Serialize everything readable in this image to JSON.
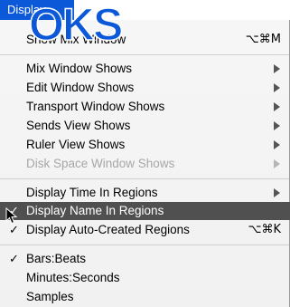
{
  "menu": {
    "title": "Display",
    "overlay_text": "OKS",
    "items": [
      {
        "label": "Show Mix Window",
        "shortcut": "⌥⌘M",
        "submenu": false,
        "checked": false,
        "enabled": true
      },
      {
        "label": "Mix Window Shows",
        "submenu": true,
        "checked": false,
        "enabled": true
      },
      {
        "label": "Edit Window Shows",
        "submenu": true,
        "checked": false,
        "enabled": true
      },
      {
        "label": "Transport Window Shows",
        "submenu": true,
        "checked": false,
        "enabled": true
      },
      {
        "label": "Sends View Shows",
        "submenu": true,
        "checked": false,
        "enabled": true
      },
      {
        "label": "Ruler View Shows",
        "submenu": true,
        "checked": false,
        "enabled": true
      },
      {
        "label": "Disk Space Window Shows",
        "submenu": true,
        "checked": false,
        "enabled": false
      },
      {
        "label": "Display Time In Regions",
        "submenu": true,
        "checked": false,
        "enabled": true
      },
      {
        "label": "Display Name In Regions",
        "submenu": false,
        "checked": true,
        "enabled": true,
        "highlighted": true
      },
      {
        "label": "Display Auto-Created Regions",
        "shortcut": "⌥⌘K",
        "submenu": false,
        "checked": true,
        "enabled": true
      },
      {
        "label": "Bars:Beats",
        "submenu": false,
        "checked": true,
        "enabled": true
      },
      {
        "label": "Minutes:Seconds",
        "submenu": false,
        "checked": false,
        "enabled": true
      },
      {
        "label": "Samples",
        "submenu": false,
        "checked": false,
        "enabled": true
      }
    ],
    "check_glyph": "✓",
    "colors": {
      "menu_title_bg": "#0b59d9",
      "highlight_bg": "#505050",
      "overlay_fill": "#0b59d9",
      "disabled_text": "#a7a7a7"
    }
  }
}
